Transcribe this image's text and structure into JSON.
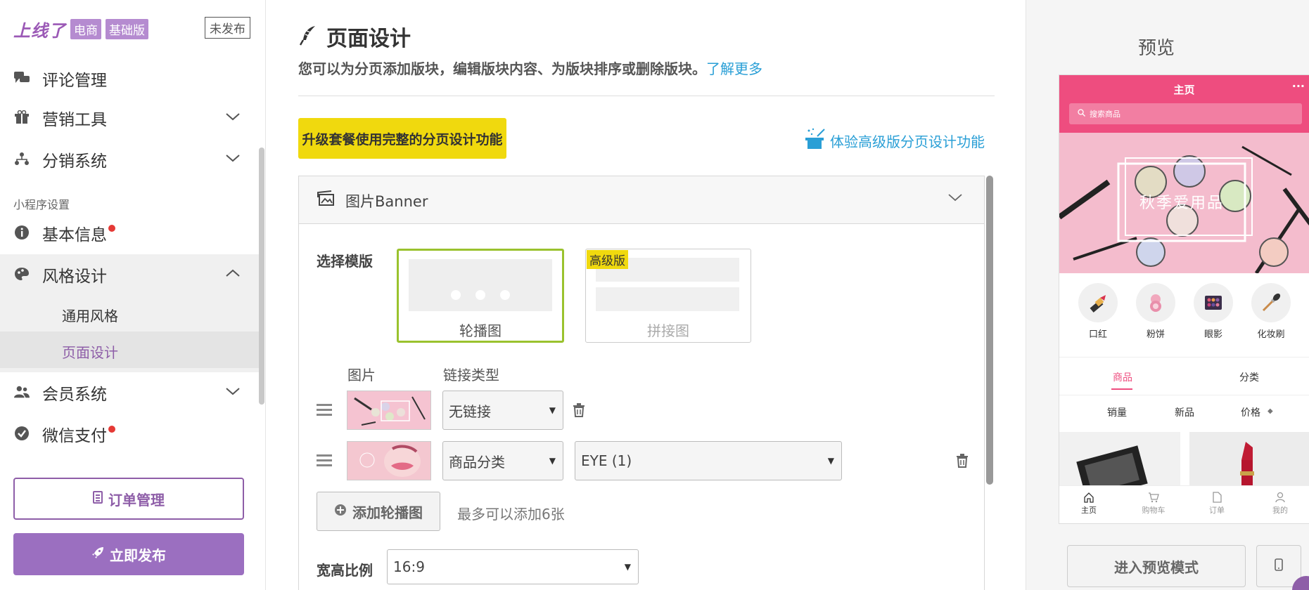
{
  "brand": {
    "name": "上线了",
    "badge1": "电商",
    "badge2": "基础版",
    "status": "未发布"
  },
  "sidebar": {
    "items": [
      {
        "label": "评论管理"
      },
      {
        "label": "营销工具"
      },
      {
        "label": "分销系统"
      },
      {
        "label": "基本信息"
      },
      {
        "label": "风格设计"
      },
      {
        "label": "会员系统"
      },
      {
        "label": "微信支付"
      }
    ],
    "section_label": "小程序设置",
    "sub_items": [
      {
        "label": "通用风格"
      },
      {
        "label": "页面设计"
      }
    ],
    "order_button": "订单管理",
    "publish_button": "立即发布"
  },
  "main": {
    "title": "页面设计",
    "description": "您可以为分页添加版块，编辑版块内容、为版块排序或删除版块。",
    "learn_more": "了解更多",
    "upgrade_button": "升级套餐使用完整的分页设计功能",
    "trial_link": "体验高级版分页设计功能",
    "panel_title": "图片Banner",
    "choose_template": "选择模版",
    "templates": [
      {
        "label": "轮播图"
      },
      {
        "label": "拼接图",
        "tag": "高级版"
      }
    ],
    "col_image": "图片",
    "col_link": "链接类型",
    "rows": [
      {
        "link_type": "无链接"
      },
      {
        "link_type": "商品分类",
        "link_target": "EYE (1)"
      }
    ],
    "add_button": "添加轮播图",
    "add_note": "最多可以添加6张",
    "ratio_label": "宽高比例",
    "ratio_value": "16:9"
  },
  "preview": {
    "title": "预览",
    "phone": {
      "header": "主页",
      "menu": "···",
      "search_placeholder": "搜索商品",
      "banner_text": "秋季爱用品",
      "categories": [
        {
          "label": "口红"
        },
        {
          "label": "粉饼"
        },
        {
          "label": "眼影"
        },
        {
          "label": "化妆刷"
        }
      ],
      "tabs": [
        {
          "label": "商品"
        },
        {
          "label": "分类"
        }
      ],
      "sort": [
        {
          "label": "销量"
        },
        {
          "label": "新品"
        },
        {
          "label": "价格"
        }
      ],
      "bottom_nav": [
        {
          "label": "主页"
        },
        {
          "label": "购物车"
        },
        {
          "label": "订单"
        },
        {
          "label": "我的"
        }
      ]
    },
    "preview_button": "进入预览模式"
  },
  "colors": {
    "brand": "#9b59b6",
    "accent": "#ee4d7f",
    "link": "#2a9fd6",
    "highlight": "#f0d90e",
    "selected": "#9ac22e"
  }
}
